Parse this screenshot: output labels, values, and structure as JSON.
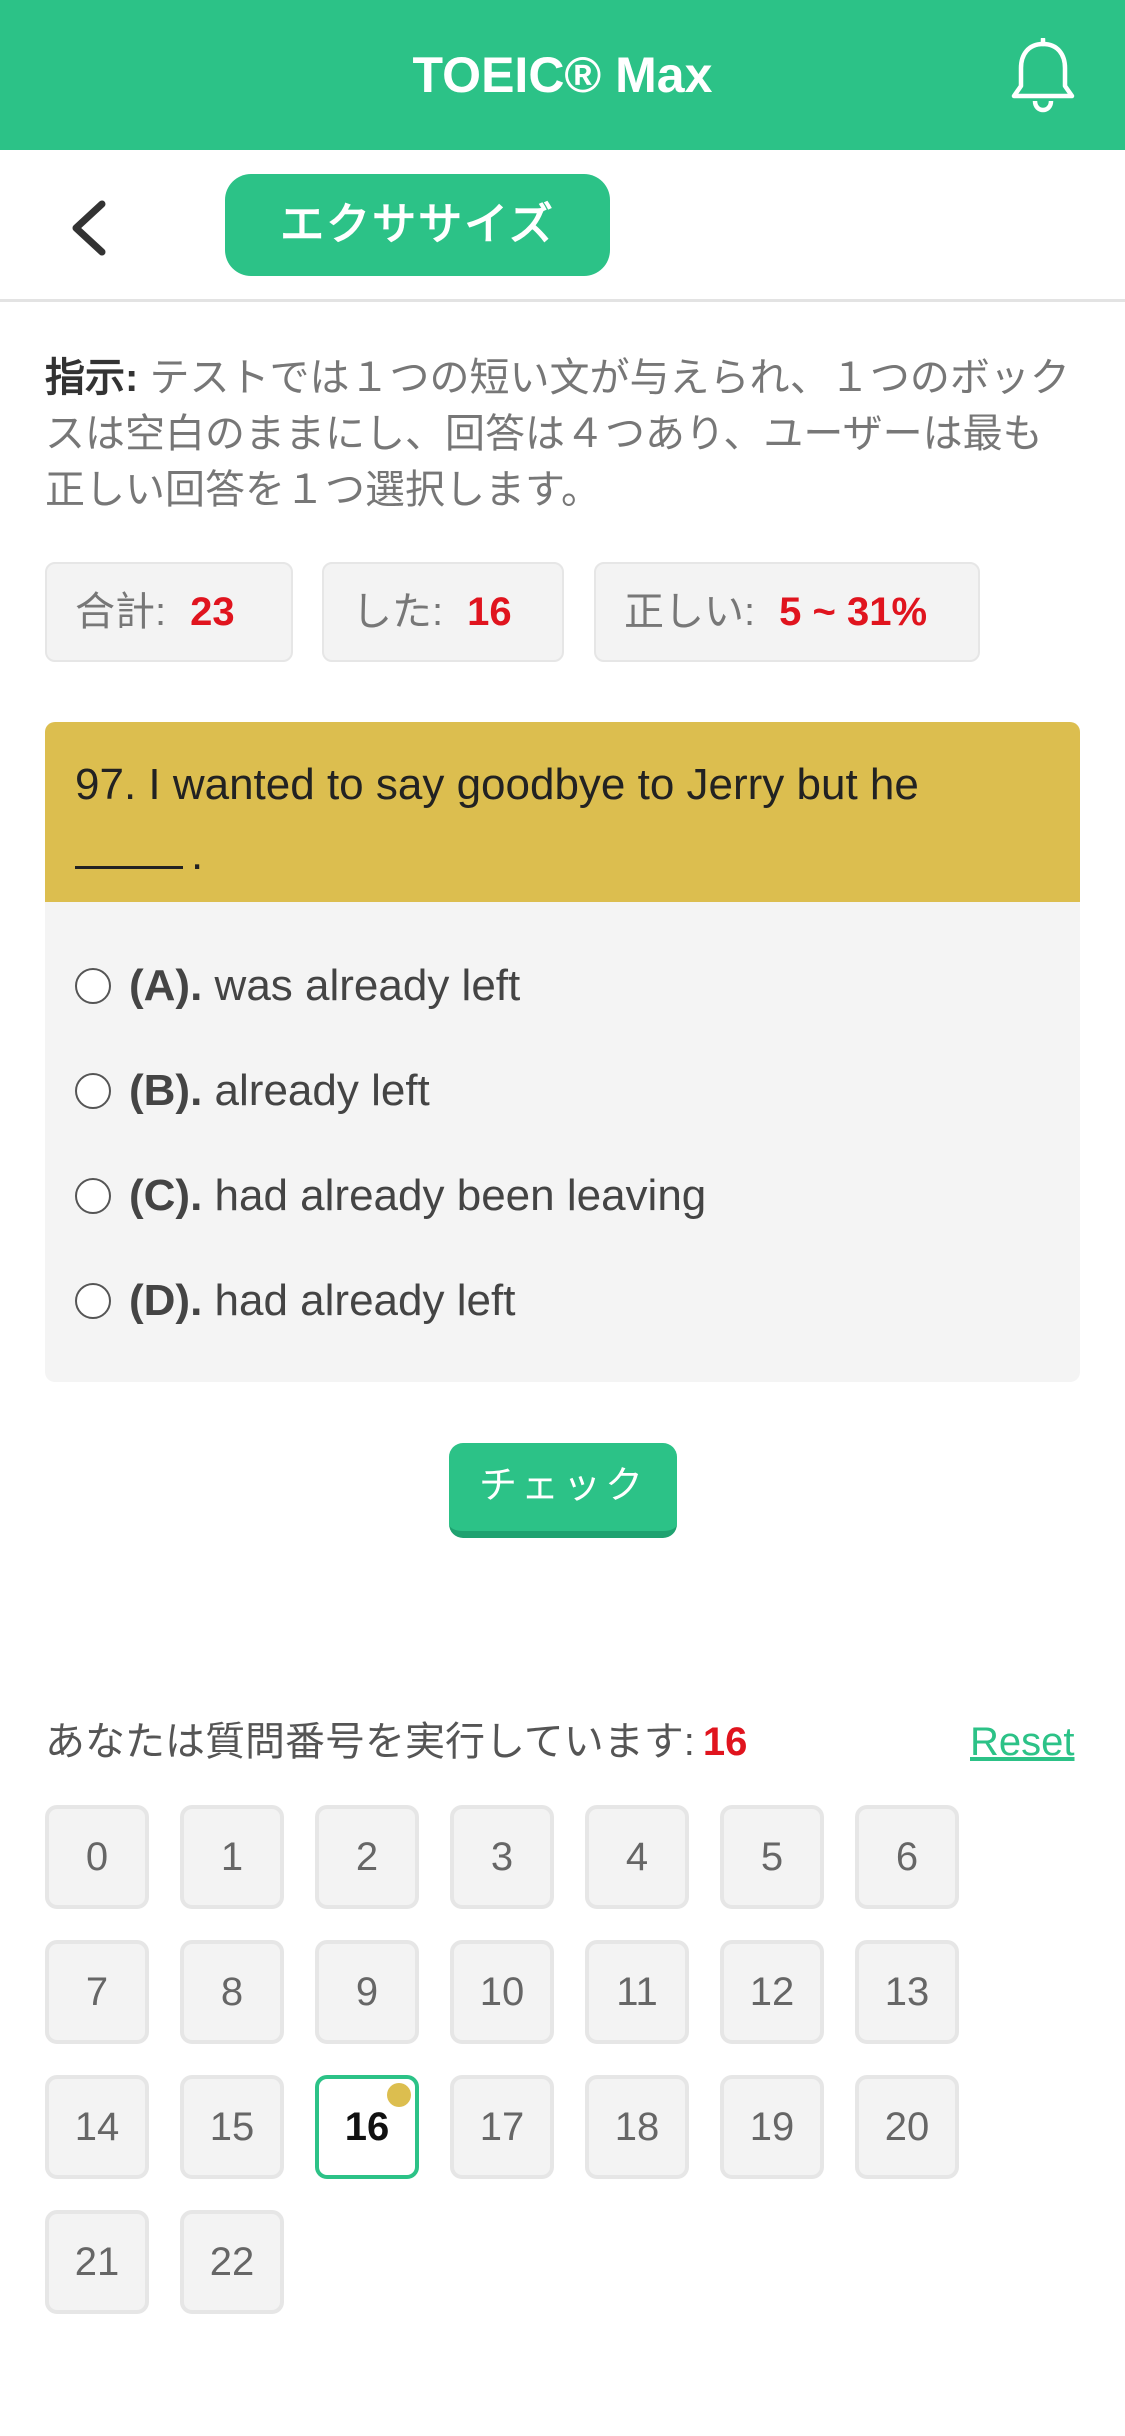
{
  "header": {
    "title": "TOEIC® Max",
    "bell_icon": "bell-icon"
  },
  "subbar": {
    "back_icon": "chevron-left-icon",
    "tab_label": "エクササイズ"
  },
  "instructions": {
    "label": "指示:",
    "text": " テストでは１つの短い文が与えられ、１つのボックスは空白のままにし、回答は４つあり、ユーザーは最も正しい回答を１つ選択します。"
  },
  "stats": {
    "total_label": "合計:",
    "total_value": "23",
    "done_label": "した:",
    "done_value": "16",
    "correct_label": "正しい:",
    "correct_value": "5 ~ 31%"
  },
  "question": {
    "text": "97. I wanted to say goodbye to Jerry but he",
    "tail": ".",
    "options": [
      {
        "letter": "(A).",
        "text": "was already left"
      },
      {
        "letter": "(B).",
        "text": "already left"
      },
      {
        "letter": "(C).",
        "text": "had already been leaving"
      },
      {
        "letter": "(D).",
        "text": "had already left"
      }
    ]
  },
  "check_label": "チェック",
  "progress": {
    "label": "あなたは質問番号を実行しています:",
    "current": "16",
    "reset_label": "Reset"
  },
  "nav": {
    "items": [
      "0",
      "1",
      "2",
      "3",
      "4",
      "5",
      "6",
      "7",
      "8",
      "9",
      "10",
      "11",
      "12",
      "13",
      "14",
      "15",
      "16",
      "17",
      "18",
      "19",
      "20",
      "21",
      "22"
    ],
    "active": "16"
  },
  "colors": {
    "brand": "#2cc287",
    "question_header": "#dcbe4f",
    "highlight": "#e0141e"
  }
}
